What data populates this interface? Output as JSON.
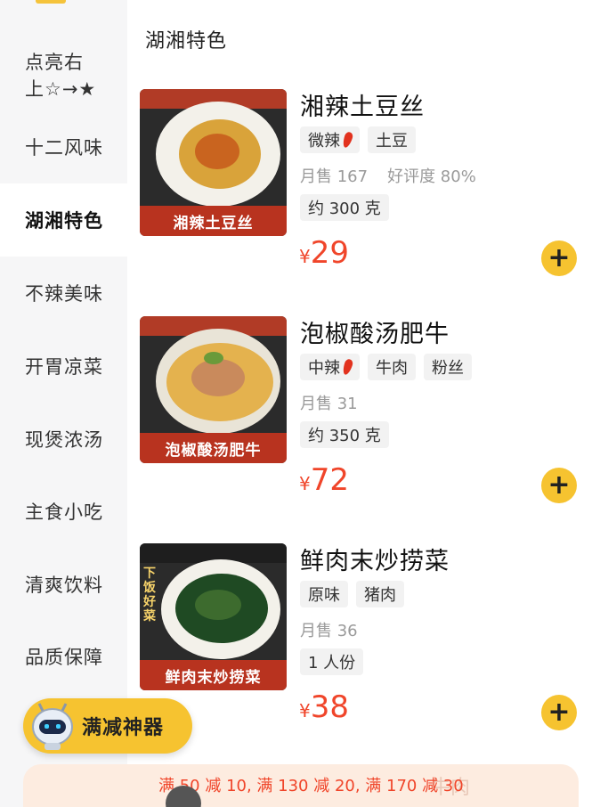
{
  "sidebar": {
    "categories": [
      {
        "label": "点亮右\n上☆→★"
      },
      {
        "label": "十二风味"
      },
      {
        "label": "湖湘特色"
      },
      {
        "label": "不辣美味"
      },
      {
        "label": "开胃凉菜"
      },
      {
        "label": "现煲浓汤"
      },
      {
        "label": "主食小吃"
      },
      {
        "label": "清爽饮料"
      },
      {
        "label": "品质保障"
      }
    ],
    "active_index": 2
  },
  "section": {
    "title": "湖湘特色"
  },
  "items": [
    {
      "name": "湘辣土豆丝",
      "tags": [
        {
          "text": "微辣",
          "spicy": true
        },
        {
          "text": "土豆"
        }
      ],
      "sales": "月售 167",
      "rating": "好评度 80%",
      "portion": "约 300 克",
      "currency": "¥",
      "price": "29",
      "image_caption": "湘辣土豆丝",
      "image_side_text": ""
    },
    {
      "name": "泡椒酸汤肥牛",
      "tags": [
        {
          "text": "中辣",
          "spicy": true
        },
        {
          "text": "牛肉"
        },
        {
          "text": "粉丝"
        }
      ],
      "sales": "月售 31",
      "rating": "",
      "portion": "约 350 克",
      "currency": "¥",
      "price": "72",
      "image_caption": "泡椒酸汤肥牛",
      "image_side_text": ""
    },
    {
      "name": "鲜肉末炒捞菜",
      "tags": [
        {
          "text": "原味"
        },
        {
          "text": "猪肉"
        }
      ],
      "sales": "月售 36",
      "rating": "",
      "portion": "1 人份",
      "currency": "¥",
      "price": "38",
      "image_caption": "鲜肉末炒捞菜",
      "image_side_text": "下饭好菜"
    }
  ],
  "add_button": {
    "symbol": "+"
  },
  "promo": {
    "label": "满减神器"
  },
  "discount_bar": {
    "text": "满 50 减 10, 满 130 减 20, 满 170 减 30",
    "ghost_text": "牛肉"
  },
  "colors": {
    "accent": "#f6c330",
    "price": "#f0452a",
    "caption_red": "#b8331f"
  }
}
